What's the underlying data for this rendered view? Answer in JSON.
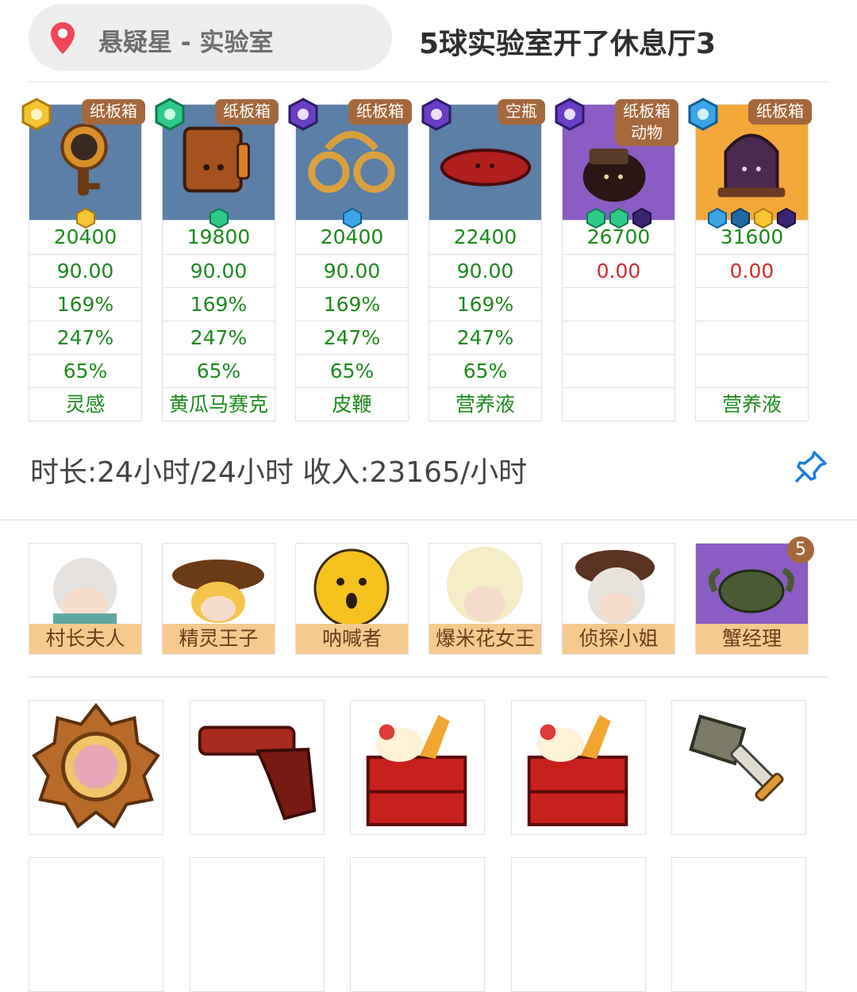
{
  "header": {
    "location": "悬疑星 - 实验室",
    "title": "5球实验室开了休息厅3"
  },
  "machines": [
    {
      "tag": "纸板箱",
      "tag2": "",
      "medal": "sun-medal-icon",
      "bg": "#5b7fa6",
      "values": [
        "20400",
        "90.00",
        "169%",
        "247%",
        "65%",
        "灵感"
      ],
      "redIdx": []
    },
    {
      "tag": "纸板箱",
      "tag2": "",
      "medal": "green-medal-icon",
      "bg": "#5b7fa6",
      "values": [
        "19800",
        "90.00",
        "169%",
        "247%",
        "65%",
        "黄瓜马赛克"
      ],
      "redIdx": []
    },
    {
      "tag": "纸板箱",
      "tag2": "",
      "medal": "moon-medal-icon",
      "bg": "#5b7fa6",
      "values": [
        "20400",
        "90.00",
        "169%",
        "247%",
        "65%",
        "皮鞭"
      ],
      "redIdx": []
    },
    {
      "tag": "空瓶",
      "tag2": "",
      "medal": "moon-medal-icon",
      "bg": "#5b7fa6",
      "values": [
        "22400",
        "90.00",
        "169%",
        "247%",
        "65%",
        "营养液"
      ],
      "redIdx": []
    },
    {
      "tag": "纸板箱",
      "tag2": "动物",
      "medal": "moon-medal-icon",
      "bg": "#8a5cc4",
      "values": [
        "26700",
        "0.00",
        "",
        "",
        "",
        ""
      ],
      "redIdx": [
        1
      ]
    },
    {
      "tag": "纸板箱",
      "tag2": "",
      "medal": "water-medal-icon",
      "bg": "#f5a83a",
      "values": [
        "31600",
        "0.00",
        "",
        "",
        "",
        "营养液"
      ],
      "redIdx": [
        1
      ]
    }
  ],
  "summary": "时长:24小时/24小时 收入:23165/小时",
  "staff": [
    {
      "name": "村长夫人"
    },
    {
      "name": "精灵王子"
    },
    {
      "name": "呐喊者"
    },
    {
      "name": "爆米花女王"
    },
    {
      "name": "侦探小姐"
    },
    {
      "name": "蟹经理"
    }
  ],
  "staff_level": "5",
  "items": [
    {
      "icon": "medal-item-icon"
    },
    {
      "icon": "pistol-item-icon"
    },
    {
      "icon": "bento-box-icon"
    },
    {
      "icon": "bento-box-icon"
    },
    {
      "icon": "sword-item-icon"
    }
  ],
  "colors": {
    "positive": "#1d8a1d",
    "negative": "#d42a2a",
    "tag": "#a5683d",
    "name_bar": "#f6c98f",
    "pin": "#1a7fe0"
  }
}
